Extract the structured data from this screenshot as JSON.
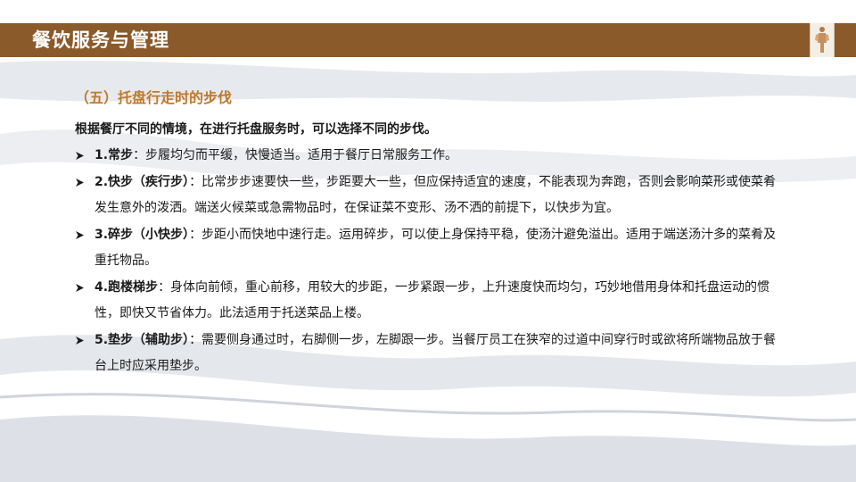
{
  "header": {
    "title": "餐饮服务与管理"
  },
  "colors": {
    "header_bar": "#8a5a2b",
    "section_title": "#c0792a",
    "text": "#1a1a1a",
    "wave": "#d9dde3"
  },
  "icons": {
    "bullet": "arrow-bullet-icon",
    "logo": "figure-logo-icon"
  },
  "main": {
    "section_title": "（五）托盘行走时的步伐",
    "intro": "根据餐厅不同的情境，在进行托盘服务时，可以选择不同的步伐。",
    "items": [
      {
        "head": "1.常步",
        "body": "：步履均匀而平缓，快慢适当。适用于餐厅日常服务工作。"
      },
      {
        "head": "2.快步（疾行步）",
        "body": "：比常步步速要快一些，步距要大一些，但应保持适宜的速度，不能表现为奔跑，否则会影响菜形或使菜肴发生意外的泼洒。端送火候菜或急需物品时，在保证菜不变形、汤不洒的前提下，以快步为宜。"
      },
      {
        "head": "3.碎步（小快步）",
        "body": "：步距小而快地中速行走。运用碎步，可以使上身保持平稳，使汤汁避免溢出。适用于端送汤汁多的菜肴及重托物品。"
      },
      {
        "head": "4.跑楼梯步",
        "body": "：身体向前倾，重心前移，用较大的步距，一步紧跟一步，上升速度快而均匀，巧妙地借用身体和托盘运动的惯性，即快又节省体力。此法适用于托送菜品上楼。"
      },
      {
        "head": "5.垫步（辅助步）",
        "body": "：需要侧身通过时，右脚侧一步，左脚跟一步。当餐厅员工在狭窄的过道中间穿行时或欲将所端物品放于餐台上时应采用垫步。"
      }
    ]
  }
}
